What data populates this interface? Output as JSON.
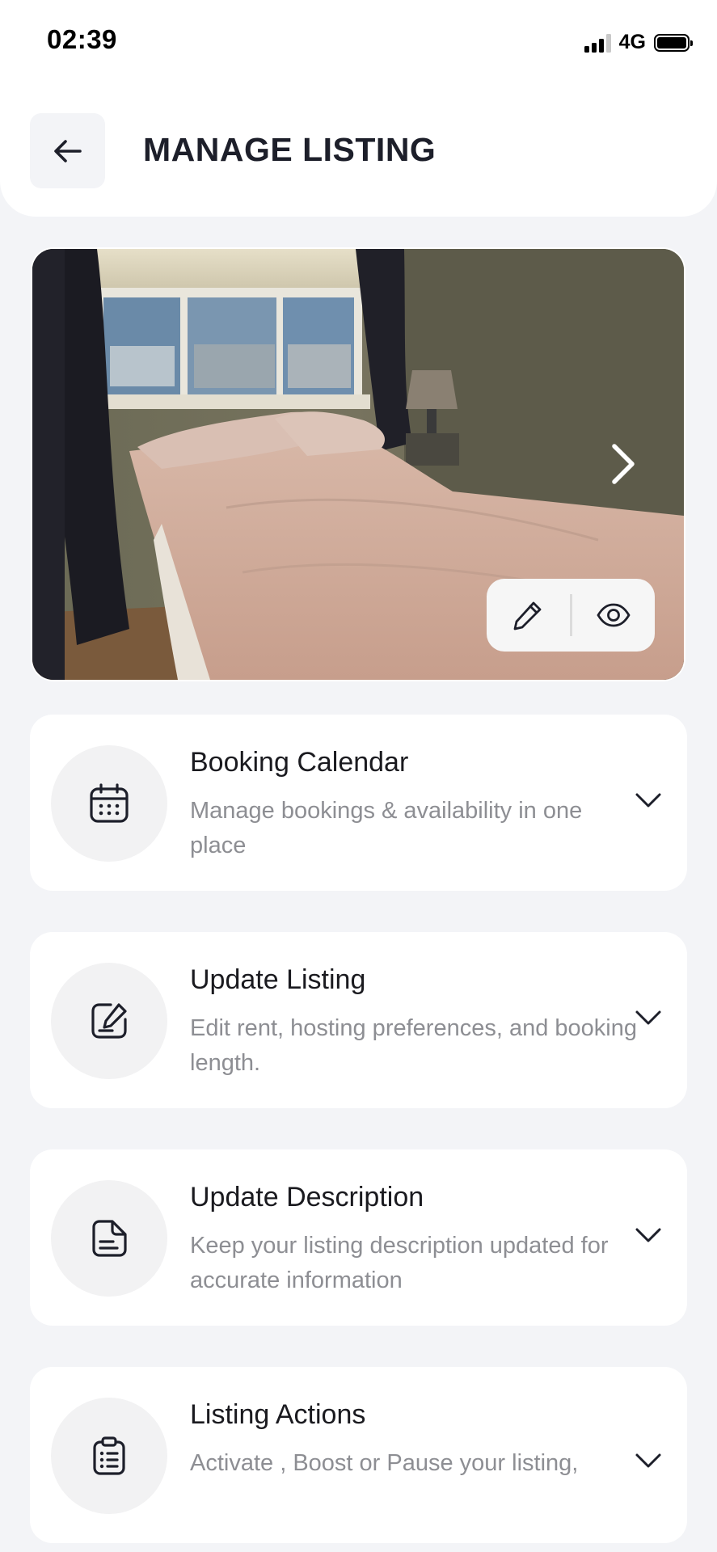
{
  "status_bar": {
    "time": "02:39",
    "network": "4G"
  },
  "header": {
    "title": "MANAGE LISTING",
    "back_icon": "arrow-left-icon"
  },
  "photo": {
    "description_icon_next": "chevron-right-icon",
    "actions": [
      {
        "icon": "pencil-icon"
      },
      {
        "icon": "eye-icon"
      }
    ]
  },
  "cards": [
    {
      "title": "Booking Calendar",
      "description": "Manage bookings & availability in one place",
      "icon": "calendar-icon"
    },
    {
      "title": "Update Listing",
      "description": "Edit rent, hosting preferences, and booking length.",
      "icon": "edit-square-icon"
    },
    {
      "title": "Update Description",
      "description": "Keep your listing description updated for accurate information",
      "icon": "document-icon"
    },
    {
      "title": "Listing Actions",
      "description": "Activate , Boost or Pause your listing,",
      "icon": "clipboard-list-icon"
    }
  ],
  "colors": {
    "background": "#f3f4f7",
    "card": "#ffffff",
    "title_text": "#1d1f2a",
    "secondary_text": "#8d8e93"
  }
}
